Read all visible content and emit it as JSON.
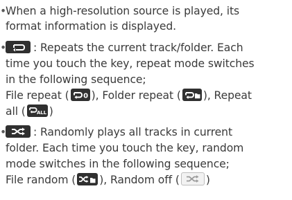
{
  "item1": {
    "line1": "When a high-resolution source is played, its",
    "line2": "format information is displayed."
  },
  "item2": {
    "key_icon": "repeat-icon",
    "line1": ": Repeats the current track/folder. Each",
    "line2": "time you touch the key, repeat mode switches",
    "line3": "in the following sequence;",
    "line4_a": "File repeat (",
    "line4_b": "), Folder repeat (",
    "line4_c": "), Repeat",
    "line5_a": "all (",
    "line5_b": ")",
    "file_repeat_icon": "file-repeat-icon",
    "file_repeat_badge": "0",
    "folder_repeat_icon": "folder-repeat-icon",
    "repeat_all_icon": "repeat-all-icon",
    "repeat_all_badge": "ALL"
  },
  "item3": {
    "key_icon": "shuffle-icon",
    "line1": ": Randomly plays all tracks in current",
    "line2": "folder. Each time you touch the key, random",
    "line3": "mode switches in the following sequence;",
    "line4_a": "File random (",
    "line4_b": "), Random off (",
    "line4_c": ")",
    "file_random_icon": "file-random-icon",
    "random_off_icon": "random-off-icon"
  },
  "colors": {
    "text": "#3a3a3a",
    "key_bg": "#303030",
    "key_fg": "#ffffff"
  }
}
